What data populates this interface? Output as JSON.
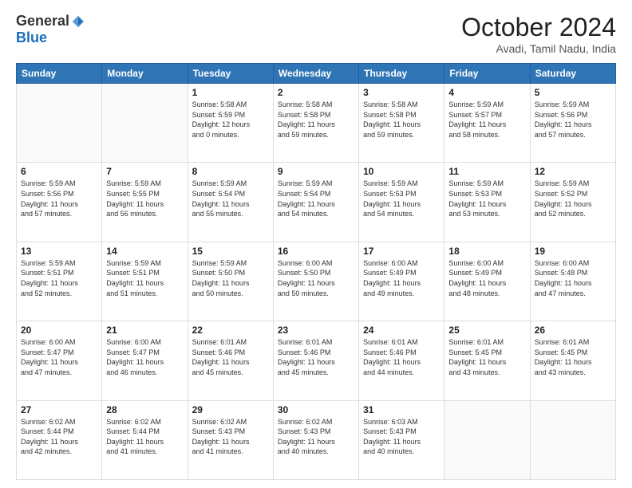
{
  "logo": {
    "general": "General",
    "blue": "Blue"
  },
  "title": "October 2024",
  "location": "Avadi, Tamil Nadu, India",
  "days_header": [
    "Sunday",
    "Monday",
    "Tuesday",
    "Wednesday",
    "Thursday",
    "Friday",
    "Saturday"
  ],
  "weeks": [
    [
      {
        "day": "",
        "info": ""
      },
      {
        "day": "",
        "info": ""
      },
      {
        "day": "1",
        "info": "Sunrise: 5:58 AM\nSunset: 5:59 PM\nDaylight: 12 hours\nand 0 minutes."
      },
      {
        "day": "2",
        "info": "Sunrise: 5:58 AM\nSunset: 5:58 PM\nDaylight: 11 hours\nand 59 minutes."
      },
      {
        "day": "3",
        "info": "Sunrise: 5:58 AM\nSunset: 5:58 PM\nDaylight: 11 hours\nand 59 minutes."
      },
      {
        "day": "4",
        "info": "Sunrise: 5:59 AM\nSunset: 5:57 PM\nDaylight: 11 hours\nand 58 minutes."
      },
      {
        "day": "5",
        "info": "Sunrise: 5:59 AM\nSunset: 5:56 PM\nDaylight: 11 hours\nand 57 minutes."
      }
    ],
    [
      {
        "day": "6",
        "info": "Sunrise: 5:59 AM\nSunset: 5:56 PM\nDaylight: 11 hours\nand 57 minutes."
      },
      {
        "day": "7",
        "info": "Sunrise: 5:59 AM\nSunset: 5:55 PM\nDaylight: 11 hours\nand 56 minutes."
      },
      {
        "day": "8",
        "info": "Sunrise: 5:59 AM\nSunset: 5:54 PM\nDaylight: 11 hours\nand 55 minutes."
      },
      {
        "day": "9",
        "info": "Sunrise: 5:59 AM\nSunset: 5:54 PM\nDaylight: 11 hours\nand 54 minutes."
      },
      {
        "day": "10",
        "info": "Sunrise: 5:59 AM\nSunset: 5:53 PM\nDaylight: 11 hours\nand 54 minutes."
      },
      {
        "day": "11",
        "info": "Sunrise: 5:59 AM\nSunset: 5:53 PM\nDaylight: 11 hours\nand 53 minutes."
      },
      {
        "day": "12",
        "info": "Sunrise: 5:59 AM\nSunset: 5:52 PM\nDaylight: 11 hours\nand 52 minutes."
      }
    ],
    [
      {
        "day": "13",
        "info": "Sunrise: 5:59 AM\nSunset: 5:51 PM\nDaylight: 11 hours\nand 52 minutes."
      },
      {
        "day": "14",
        "info": "Sunrise: 5:59 AM\nSunset: 5:51 PM\nDaylight: 11 hours\nand 51 minutes."
      },
      {
        "day": "15",
        "info": "Sunrise: 5:59 AM\nSunset: 5:50 PM\nDaylight: 11 hours\nand 50 minutes."
      },
      {
        "day": "16",
        "info": "Sunrise: 6:00 AM\nSunset: 5:50 PM\nDaylight: 11 hours\nand 50 minutes."
      },
      {
        "day": "17",
        "info": "Sunrise: 6:00 AM\nSunset: 5:49 PM\nDaylight: 11 hours\nand 49 minutes."
      },
      {
        "day": "18",
        "info": "Sunrise: 6:00 AM\nSunset: 5:49 PM\nDaylight: 11 hours\nand 48 minutes."
      },
      {
        "day": "19",
        "info": "Sunrise: 6:00 AM\nSunset: 5:48 PM\nDaylight: 11 hours\nand 47 minutes."
      }
    ],
    [
      {
        "day": "20",
        "info": "Sunrise: 6:00 AM\nSunset: 5:47 PM\nDaylight: 11 hours\nand 47 minutes."
      },
      {
        "day": "21",
        "info": "Sunrise: 6:00 AM\nSunset: 5:47 PM\nDaylight: 11 hours\nand 46 minutes."
      },
      {
        "day": "22",
        "info": "Sunrise: 6:01 AM\nSunset: 5:46 PM\nDaylight: 11 hours\nand 45 minutes."
      },
      {
        "day": "23",
        "info": "Sunrise: 6:01 AM\nSunset: 5:46 PM\nDaylight: 11 hours\nand 45 minutes."
      },
      {
        "day": "24",
        "info": "Sunrise: 6:01 AM\nSunset: 5:46 PM\nDaylight: 11 hours\nand 44 minutes."
      },
      {
        "day": "25",
        "info": "Sunrise: 6:01 AM\nSunset: 5:45 PM\nDaylight: 11 hours\nand 43 minutes."
      },
      {
        "day": "26",
        "info": "Sunrise: 6:01 AM\nSunset: 5:45 PM\nDaylight: 11 hours\nand 43 minutes."
      }
    ],
    [
      {
        "day": "27",
        "info": "Sunrise: 6:02 AM\nSunset: 5:44 PM\nDaylight: 11 hours\nand 42 minutes."
      },
      {
        "day": "28",
        "info": "Sunrise: 6:02 AM\nSunset: 5:44 PM\nDaylight: 11 hours\nand 41 minutes."
      },
      {
        "day": "29",
        "info": "Sunrise: 6:02 AM\nSunset: 5:43 PM\nDaylight: 11 hours\nand 41 minutes."
      },
      {
        "day": "30",
        "info": "Sunrise: 6:02 AM\nSunset: 5:43 PM\nDaylight: 11 hours\nand 40 minutes."
      },
      {
        "day": "31",
        "info": "Sunrise: 6:03 AM\nSunset: 5:43 PM\nDaylight: 11 hours\nand 40 minutes."
      },
      {
        "day": "",
        "info": ""
      },
      {
        "day": "",
        "info": ""
      }
    ]
  ]
}
